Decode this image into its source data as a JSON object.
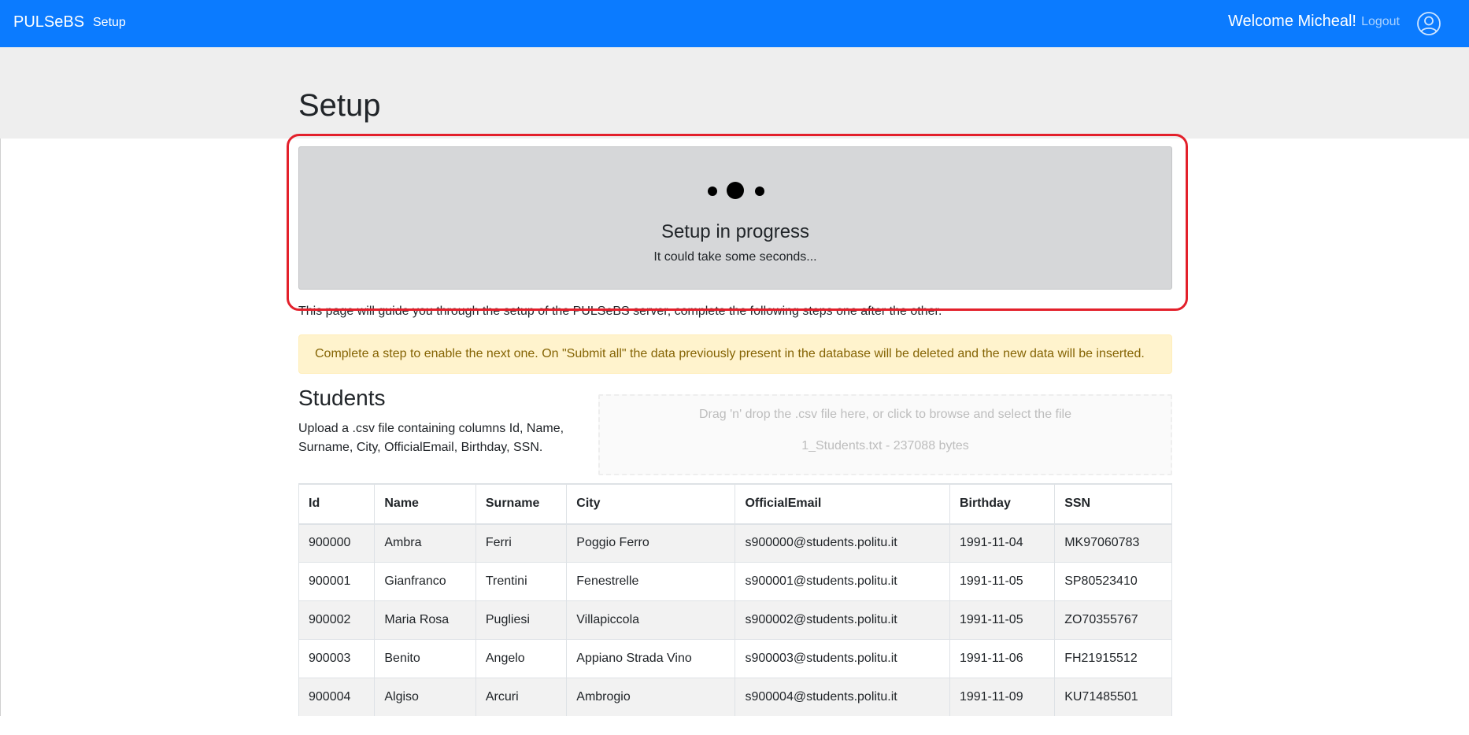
{
  "navbar": {
    "brand": "PULSeBS",
    "setup_link": "Setup",
    "welcome": "Welcome Micheal!",
    "logout": "Logout",
    "user_icon": "user-circle-icon"
  },
  "page": {
    "title": "Setup",
    "intro": "This page will guide you through the setup of the PULSeBS server, complete the following steps one after the other."
  },
  "progress": {
    "title": "Setup in progress",
    "subtitle": "It could take some seconds..."
  },
  "alert": {
    "text": "Complete a step to enable the next one. On \"Submit all\" the data previously present in the database will be deleted and the new data will be inserted."
  },
  "students": {
    "title": "Students",
    "description": "Upload a .csv file containing columns Id, Name, Surname, City, OfficialEmail, Birthday, SSN.",
    "dropzone_prompt": "Drag 'n' drop the .csv file here, or click to browse and select the file",
    "dropzone_file": "1_Students.txt - 237088 bytes",
    "columns": [
      "Id",
      "Name",
      "Surname",
      "City",
      "OfficialEmail",
      "Birthday",
      "SSN"
    ],
    "rows": [
      [
        "900000",
        "Ambra",
        "Ferri",
        "Poggio Ferro",
        "s900000@students.politu.it",
        "1991-11-04",
        "MK97060783"
      ],
      [
        "900001",
        "Gianfranco",
        "Trentini",
        "Fenestrelle",
        "s900001@students.politu.it",
        "1991-11-05",
        "SP80523410"
      ],
      [
        "900002",
        "Maria Rosa",
        "Pugliesi",
        "Villapiccola",
        "s900002@students.politu.it",
        "1991-11-05",
        "ZO70355767"
      ],
      [
        "900003",
        "Benito",
        "Angelo",
        "Appiano Strada Vino",
        "s900003@students.politu.it",
        "1991-11-06",
        "FH21915512"
      ],
      [
        "900004",
        "Algiso",
        "Arcuri",
        "Ambrogio",
        "s900004@students.politu.it",
        "1991-11-09",
        "KU71485501"
      ]
    ]
  },
  "colors": {
    "navbar": "#0b7bff",
    "highlight": "#e3202b",
    "alert_bg": "#fff3cd",
    "alert_text": "#856404"
  }
}
